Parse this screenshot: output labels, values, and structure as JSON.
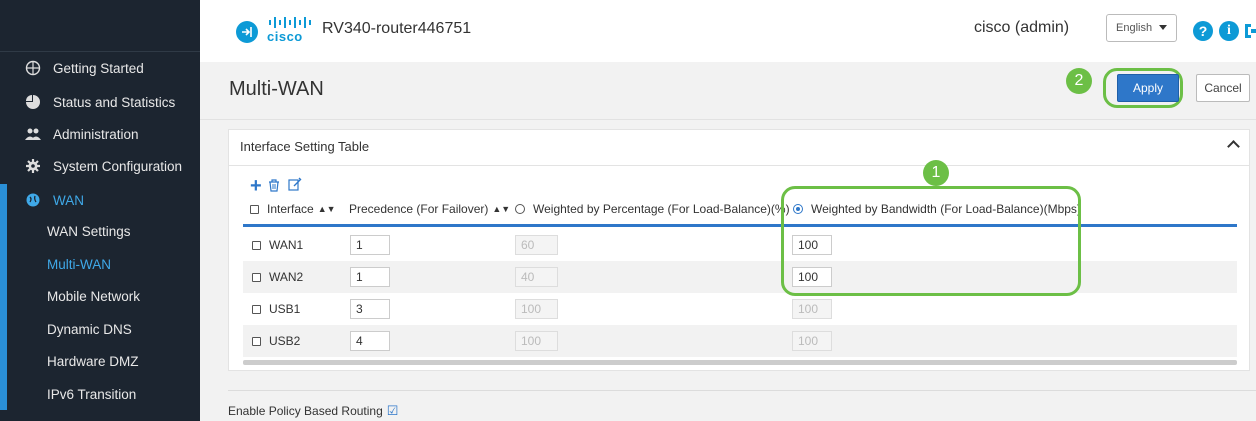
{
  "header": {
    "router_name": "RV340-router446751",
    "cisco_word": "cisco",
    "user": "cisco (admin)",
    "language": "English"
  },
  "sidebar": {
    "items": [
      {
        "label": "Getting Started",
        "icon": "getting-started-icon"
      },
      {
        "label": "Status and Statistics",
        "icon": "pie-chart-icon"
      },
      {
        "label": "Administration",
        "icon": "users-icon"
      },
      {
        "label": "System Configuration",
        "icon": "gear-icon"
      },
      {
        "label": "WAN",
        "icon": "globe-icon",
        "active": true
      }
    ],
    "wan_subitems": [
      {
        "label": "WAN Settings"
      },
      {
        "label": "Multi-WAN",
        "active": true
      },
      {
        "label": "Mobile Network"
      },
      {
        "label": "Dynamic DNS"
      },
      {
        "label": "Hardware DMZ"
      },
      {
        "label": "IPv6 Transition"
      }
    ]
  },
  "page": {
    "title": "Multi-WAN",
    "apply_label": "Apply",
    "cancel_label": "Cancel",
    "annotation_step_1": "1",
    "annotation_step_2": "2"
  },
  "panel": {
    "title": "Interface Setting Table",
    "columns": {
      "interface": "Interface",
      "precedence": "Precedence (For Failover)",
      "weighted_percentage": "Weighted by Percentage (For Load-Balance)(%)",
      "weighted_bandwidth": "Weighted by Bandwidth (For Load-Balance)(Mbps)"
    },
    "rows": [
      {
        "interface": "WAN1",
        "precedence": "1",
        "percentage": "60",
        "bandwidth": "100"
      },
      {
        "interface": "WAN2",
        "precedence": "1",
        "percentage": "40",
        "bandwidth": "100"
      },
      {
        "interface": "USB1",
        "precedence": "3",
        "percentage": "100",
        "bandwidth": "100"
      },
      {
        "interface": "USB2",
        "precedence": "4",
        "percentage": "100",
        "bandwidth": "100"
      }
    ]
  },
  "policy_routing_label": "Enable Policy Based Routing",
  "colors": {
    "accent": "#2e77c9",
    "sidebar_bg": "#1c2530",
    "highlight": "#6cbf46"
  }
}
